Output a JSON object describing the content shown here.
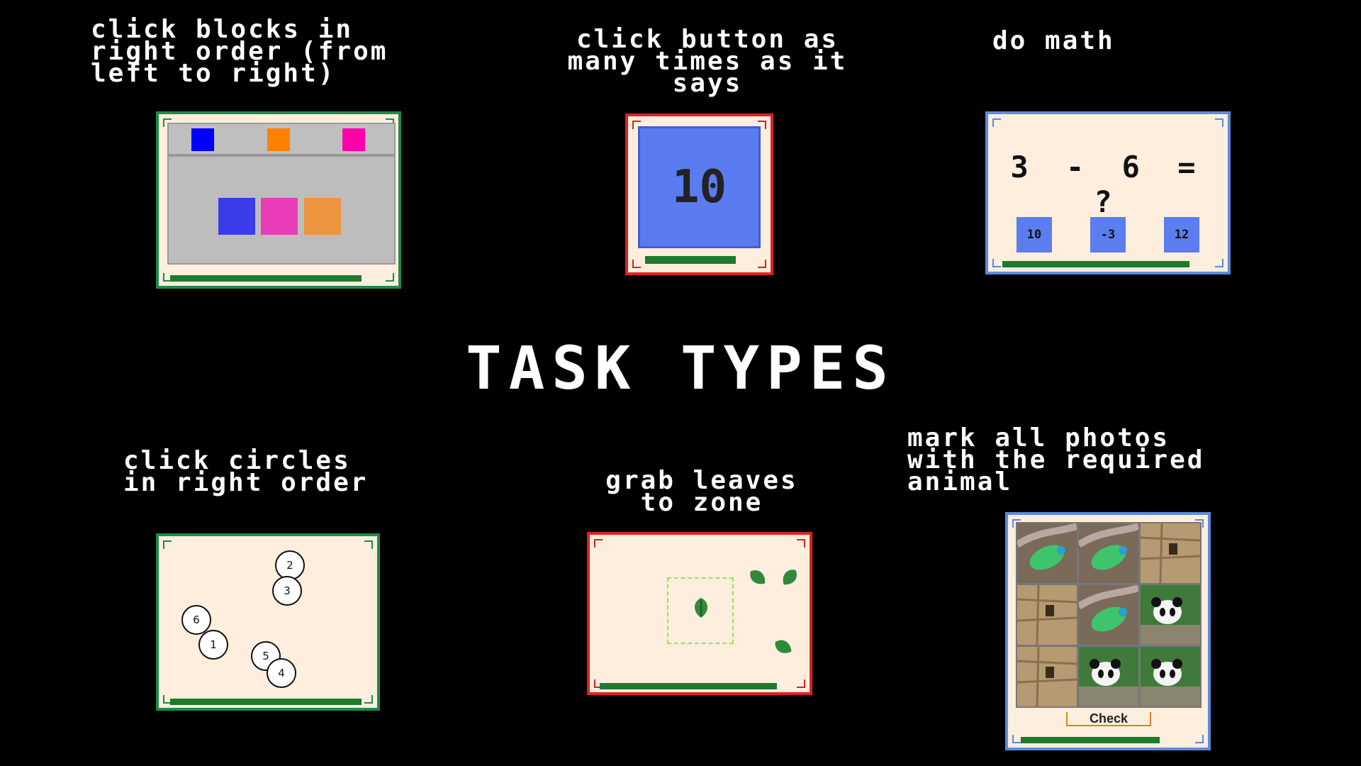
{
  "title": "TASK TYPES",
  "tasks": {
    "blocks": {
      "caption": "click blocks in\nright order (from\nleft to right)",
      "top_colors": [
        "#0000ff",
        "#ff8000",
        "#ff00aa"
      ],
      "bottom_colors": [
        "#3b3bea",
        "#e83cb8",
        "#ec9440"
      ],
      "progress": 1.0
    },
    "counter": {
      "caption": "click button as\nmany times as it\nsays",
      "button_value": "10",
      "progress": 1.0
    },
    "math": {
      "caption": "do math",
      "equation": "3 - 6 = ?",
      "options": [
        "10",
        "-3",
        "12"
      ],
      "progress": 1.0
    },
    "circles": {
      "caption": "click circles\nin right order",
      "numbers": [
        "2",
        "3",
        "6",
        "1",
        "5",
        "4"
      ],
      "progress": 1.0
    },
    "leaves": {
      "caption": "grab leaves\nto zone",
      "progress": 1.0
    },
    "photos": {
      "caption": "mark all photos\nwith the required\nanimal",
      "tiles": [
        "bird",
        "bird",
        "wood",
        "wood",
        "bird",
        "panda",
        "wood",
        "panda",
        "panda"
      ],
      "check_label": "Check",
      "progress": 1.0
    }
  },
  "colors": {
    "accent_green": "#1e7a2e",
    "card_bg": "#fdeedd",
    "frame_green": "#1e8a4a",
    "frame_red": "#e02020",
    "frame_blue": "#5a8be0"
  }
}
